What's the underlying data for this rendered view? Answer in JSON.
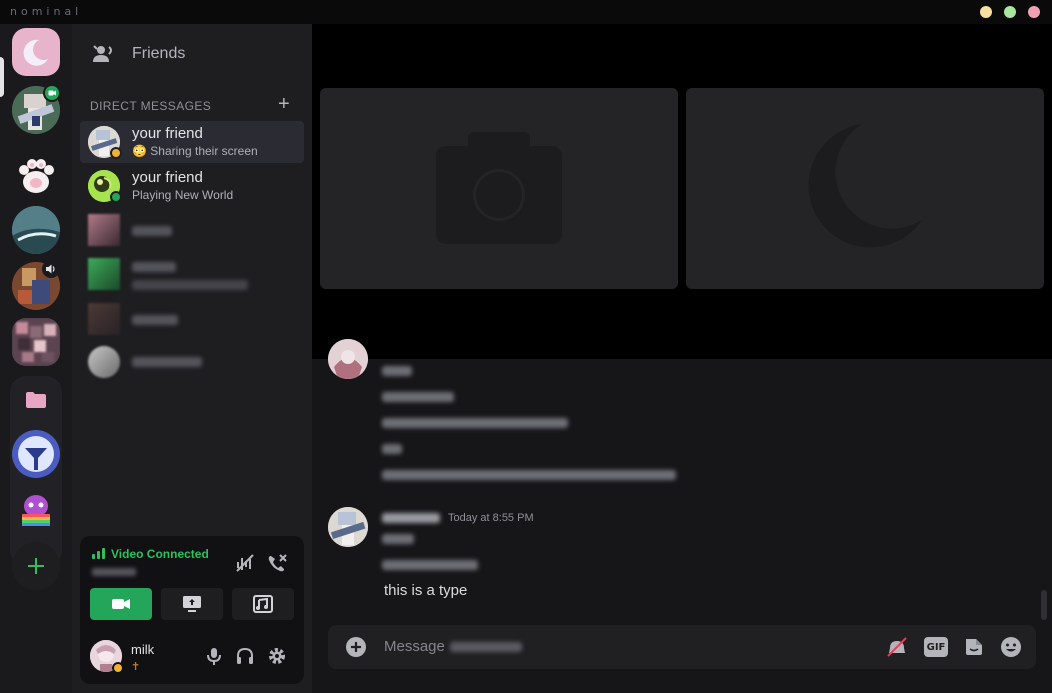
{
  "app": {
    "name": "nominal"
  },
  "window_controls": [
    {
      "name": "minimize",
      "color": "#f7dfa2"
    },
    {
      "name": "maximize",
      "color": "#a8e6a0"
    },
    {
      "name": "close",
      "color": "#f0a2b4"
    }
  ],
  "sidebar": {
    "friends_label": "Friends",
    "dm_header": "DIRECT MESSAGES",
    "dm_add": "+",
    "dms": [
      {
        "name": "your friend",
        "status": "Sharing their screen",
        "activity_emoji": "😳"
      },
      {
        "name": "your friend",
        "status": "Playing New World"
      }
    ]
  },
  "voice": {
    "status": "Video Connected",
    "accent": "#23a55a"
  },
  "user": {
    "name": "milk",
    "custom_status": "✝"
  },
  "chat": {
    "timestamp": "Today at 8:55 PM",
    "last_message": "this is a type"
  },
  "composer": {
    "placeholder": "Message",
    "gif_label": "GIF"
  },
  "colors": {
    "online": "#23a55a",
    "idle": "#f0b232",
    "selected_server": "#e8b4cc",
    "folder": "#e8a6c4"
  }
}
